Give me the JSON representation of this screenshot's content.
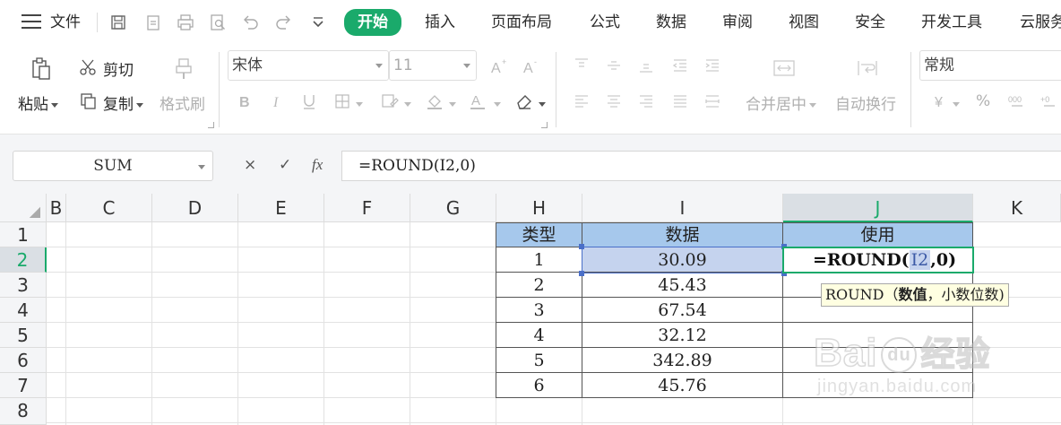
{
  "menu": {
    "file_label": "文件",
    "tabs": [
      "开始",
      "插入",
      "页面布局",
      "公式",
      "数据",
      "审阅",
      "视图",
      "安全",
      "开发工具",
      "云服务"
    ],
    "active_tab": "开始"
  },
  "ribbon": {
    "paste": "粘贴",
    "cut": "剪切",
    "copy": "复制",
    "format_painter": "格式刷",
    "font_name": "宋体",
    "font_size": "11",
    "merge_center": "合并居中",
    "wrap_text": "自动换行",
    "number_format": "常规",
    "percent": "%"
  },
  "formula_bar": {
    "name_box": "SUM",
    "cancel": "×",
    "confirm": "✓",
    "fx": "fx",
    "formula": "=ROUND(I2,0)"
  },
  "grid": {
    "corner": "◢",
    "columns": [
      "B",
      "C",
      "D",
      "E",
      "F",
      "G",
      "H",
      "I",
      "J",
      "K"
    ],
    "rows": [
      "1",
      "2",
      "3",
      "4",
      "5",
      "6",
      "7",
      "8"
    ],
    "selected_column": "J",
    "selected_row": "2",
    "table": {
      "headers": [
        "类型",
        "数据",
        "使用"
      ],
      "rows": [
        [
          "1",
          "30.09",
          ""
        ],
        [
          "2",
          "45.43",
          ""
        ],
        [
          "3",
          "67.54",
          ""
        ],
        [
          "4",
          "32.12",
          ""
        ],
        [
          "5",
          "342.89",
          ""
        ],
        [
          "6",
          "45.76",
          ""
        ]
      ]
    },
    "editing_cell": {
      "prefix": "=ROUND(",
      "ref": "I2",
      "suffix": ",0)"
    },
    "tooltip": {
      "func": "ROUND",
      "open": "（",
      "arg1": "数值",
      "sep": "，",
      "arg2": "小数位数",
      "close": ")"
    }
  },
  "watermark": {
    "brand": "Bai",
    "paw": "du",
    "suffix": "经验",
    "url": "jingyan.baidu.com"
  },
  "colors": {
    "accent": "#1aaa6b",
    "header_fill": "#a6c8ec",
    "ref_highlight": "#c5d3ee"
  }
}
